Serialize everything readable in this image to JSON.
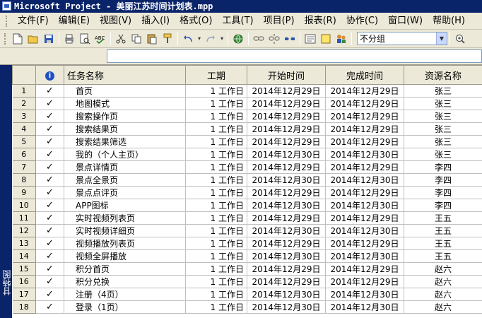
{
  "window": {
    "title": "Microsoft Project - 美丽江苏时间计划表.mpp"
  },
  "menu": [
    {
      "label": "文件",
      "hotkey": "(F)"
    },
    {
      "label": "编辑",
      "hotkey": "(E)"
    },
    {
      "label": "视图",
      "hotkey": "(V)"
    },
    {
      "label": "插入",
      "hotkey": "(I)"
    },
    {
      "label": "格式",
      "hotkey": "(O)"
    },
    {
      "label": "工具",
      "hotkey": "(T)"
    },
    {
      "label": "项目",
      "hotkey": "(P)"
    },
    {
      "label": "报表",
      "hotkey": "(R)"
    },
    {
      "label": "协作",
      "hotkey": "(C)"
    },
    {
      "label": "窗口",
      "hotkey": "(W)"
    },
    {
      "label": "帮助",
      "hotkey": "(H)"
    }
  ],
  "toolbar": {
    "group_select_value": "不分组"
  },
  "viewbar": {
    "label": "甘特图"
  },
  "table": {
    "headers": {
      "info": "i",
      "name": "任务名称",
      "duration": "工期",
      "start": "开始时间",
      "finish": "完成时间",
      "resource": "资源名称"
    },
    "rows": [
      {
        "id": "1",
        "done": "✓",
        "name": "首页",
        "duration": "1 工作日",
        "start": "2014年12月29日",
        "finish": "2014年12月29日",
        "resource": "张三"
      },
      {
        "id": "2",
        "done": "✓",
        "name": "地图模式",
        "duration": "1 工作日",
        "start": "2014年12月29日",
        "finish": "2014年12月29日",
        "resource": "张三"
      },
      {
        "id": "3",
        "done": "✓",
        "name": "搜索操作页",
        "duration": "1 工作日",
        "start": "2014年12月29日",
        "finish": "2014年12月29日",
        "resource": "张三"
      },
      {
        "id": "4",
        "done": "✓",
        "name": "搜索结果页",
        "duration": "1 工作日",
        "start": "2014年12月29日",
        "finish": "2014年12月29日",
        "resource": "张三"
      },
      {
        "id": "5",
        "done": "✓",
        "name": "搜索结果筛选",
        "duration": "1 工作日",
        "start": "2014年12月29日",
        "finish": "2014年12月29日",
        "resource": "张三"
      },
      {
        "id": "6",
        "done": "✓",
        "name": "我的（个人主页）",
        "duration": "1 工作日",
        "start": "2014年12月30日",
        "finish": "2014年12月30日",
        "resource": "张三"
      },
      {
        "id": "7",
        "done": "✓",
        "name": "景点详情页",
        "duration": "1 工作日",
        "start": "2014年12月29日",
        "finish": "2014年12月29日",
        "resource": "李四"
      },
      {
        "id": "8",
        "done": "✓",
        "name": "景点全景页",
        "duration": "1 工作日",
        "start": "2014年12月30日",
        "finish": "2014年12月30日",
        "resource": "李四"
      },
      {
        "id": "9",
        "done": "✓",
        "name": "景点点评页",
        "duration": "1 工作日",
        "start": "2014年12月29日",
        "finish": "2014年12月29日",
        "resource": "李四"
      },
      {
        "id": "10",
        "done": "✓",
        "name": "APP图标",
        "duration": "1 工作日",
        "start": "2014年12月30日",
        "finish": "2014年12月30日",
        "resource": "李四"
      },
      {
        "id": "11",
        "done": "✓",
        "name": "实时视频列表页",
        "duration": "1 工作日",
        "start": "2014年12月29日",
        "finish": "2014年12月29日",
        "resource": "王五"
      },
      {
        "id": "12",
        "done": "✓",
        "name": "实时视频详细页",
        "duration": "1 工作日",
        "start": "2014年12月30日",
        "finish": "2014年12月30日",
        "resource": "王五"
      },
      {
        "id": "13",
        "done": "✓",
        "name": "视频播放列表页",
        "duration": "1 工作日",
        "start": "2014年12月29日",
        "finish": "2014年12月29日",
        "resource": "王五"
      },
      {
        "id": "14",
        "done": "✓",
        "name": "视频全屏播放",
        "duration": "1 工作日",
        "start": "2014年12月30日",
        "finish": "2014年12月30日",
        "resource": "王五"
      },
      {
        "id": "15",
        "done": "✓",
        "name": "积分首页",
        "duration": "1 工作日",
        "start": "2014年12月29日",
        "finish": "2014年12月29日",
        "resource": "赵六"
      },
      {
        "id": "16",
        "done": "✓",
        "name": "积分兑换",
        "duration": "1 工作日",
        "start": "2014年12月29日",
        "finish": "2014年12月29日",
        "resource": "赵六"
      },
      {
        "id": "17",
        "done": "✓",
        "name": "注册（4页）",
        "duration": "1 工作日",
        "start": "2014年12月30日",
        "finish": "2014年12月30日",
        "resource": "赵六"
      },
      {
        "id": "18",
        "done": "✓",
        "name": "登录（1页）",
        "duration": "1 工作日",
        "start": "2014年12月30日",
        "finish": "2014年12月30日",
        "resource": "赵六"
      }
    ]
  },
  "colors": {
    "titlebar": "#0a246a",
    "chrome": "#ece9d8",
    "viewbar": "#0a246a"
  }
}
